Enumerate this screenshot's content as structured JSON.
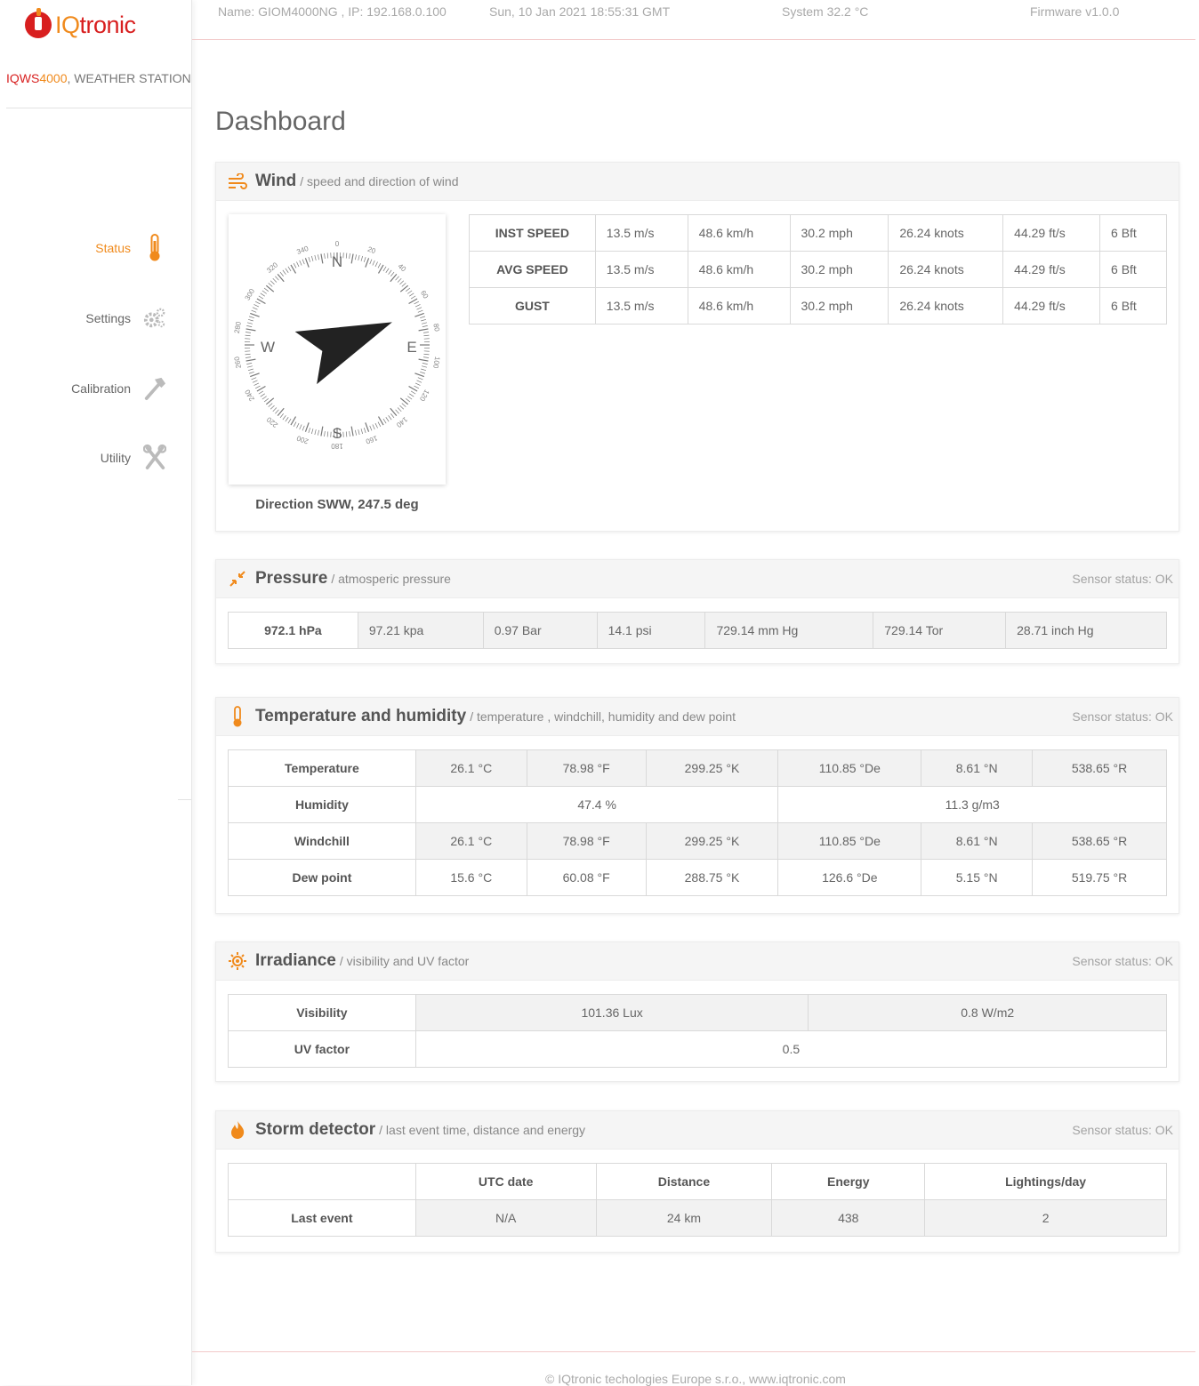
{
  "brand": {
    "logo_text_1": "IQ",
    "logo_text_2": "tronic",
    "product_1": "IQWS",
    "product_2": "4000",
    "product_3": ", WEATHER STATION"
  },
  "colors": {
    "accent": "#f08a1c",
    "brand_red": "#d81f1f"
  },
  "topbar": {
    "name": "Name: GIOM4000NG , IP: 192.168.0.100",
    "datetime": "Sun, 10 Jan 2021 18:55:31 GMT",
    "system": "System 32.2 °C",
    "firmware": "Firmware v1.0.0"
  },
  "nav": [
    {
      "label": "Status",
      "icon": "thermometer-icon",
      "active": true
    },
    {
      "label": "Settings",
      "icon": "gears-icon",
      "active": false
    },
    {
      "label": "Calibration",
      "icon": "hammer-icon",
      "active": false
    },
    {
      "label": "Utility",
      "icon": "tools-icon",
      "active": false
    }
  ],
  "page_title": "Dashboard",
  "wind": {
    "title": "Wind",
    "subtitle": "/ speed and direction of wind",
    "direction_deg": 247.5,
    "direction_text": "Direction SWW, 247.5 deg",
    "compass": {
      "n": "N",
      "e": "E",
      "s": "S",
      "w": "W",
      "ticks": [
        "0",
        "20",
        "40",
        "60",
        "80",
        "100",
        "120",
        "140",
        "160",
        "180",
        "200",
        "220",
        "240",
        "260",
        "280",
        "300",
        "320",
        "340"
      ]
    },
    "rows": [
      {
        "label": "INST SPEED",
        "values": [
          "13.5 m/s",
          "48.6 km/h",
          "30.2 mph",
          "26.24 knots",
          "44.29 ft/s",
          "6 Bft"
        ]
      },
      {
        "label": "AVG SPEED",
        "values": [
          "13.5 m/s",
          "48.6 km/h",
          "30.2 mph",
          "26.24 knots",
          "44.29 ft/s",
          "6 Bft"
        ]
      },
      {
        "label": "GUST",
        "values": [
          "13.5 m/s",
          "48.6 km/h",
          "30.2 mph",
          "26.24 knots",
          "44.29 ft/s",
          "6 Bft"
        ]
      }
    ]
  },
  "pressure": {
    "title": "Pressure",
    "subtitle": "/ atmosperic pressure",
    "status": "Sensor status: OK",
    "values": [
      "972.1 hPa",
      "97.21 kpa",
      "0.97 Bar",
      "14.1 psi",
      "729.14 mm Hg",
      "729.14 Tor",
      "28.71 inch Hg"
    ]
  },
  "temperature": {
    "title": "Temperature and humidity",
    "subtitle": "/ temperature , windchill, humidity and dew point",
    "status": "Sensor status: OK",
    "rows": [
      {
        "label": "Temperature",
        "values": [
          "26.1 °C",
          "78.98 °F",
          "299.25 °K",
          "110.85 °De",
          "8.61 °N",
          "538.65 °R"
        ]
      },
      {
        "label": "Humidity",
        "values": [
          "47.4 %",
          "11.3 g/m3"
        ]
      },
      {
        "label": "Windchill",
        "values": [
          "26.1 °C",
          "78.98 °F",
          "299.25 °K",
          "110.85 °De",
          "8.61 °N",
          "538.65 °R"
        ]
      },
      {
        "label": "Dew point",
        "values": [
          "15.6 °C",
          "60.08 °F",
          "288.75 °K",
          "126.6 °De",
          "5.15 °N",
          "519.75 °R"
        ]
      }
    ]
  },
  "irradiance": {
    "title": "Irradiance",
    "subtitle": "/ visibility and UV factor",
    "status": "Sensor status: OK",
    "visibility_label": "Visibility",
    "visibility_values": [
      "101.36 Lux",
      "0.8 W/m2"
    ],
    "uv_label": "UV factor",
    "uv_value": "0.5"
  },
  "storm": {
    "title": "Storm detector",
    "subtitle": "/ last event time, distance and energy",
    "status": "Sensor status: OK",
    "headers": [
      "",
      "UTC date",
      "Distance",
      "Energy",
      "Lightings/day"
    ],
    "row": {
      "label": "Last event",
      "values": [
        "N/A",
        "24 km",
        "438",
        "2"
      ]
    }
  },
  "footer": "© IQtronic techologies Europe s.r.o., www.iqtronic.com"
}
